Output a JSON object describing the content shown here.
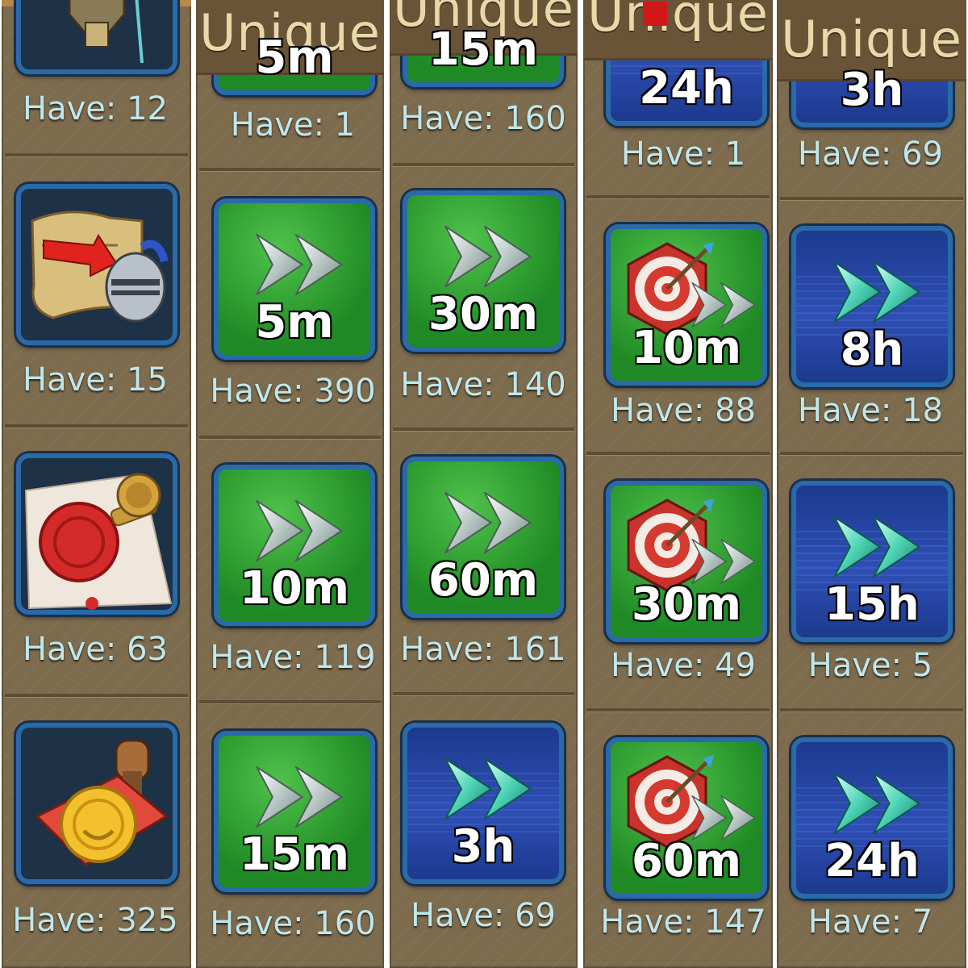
{
  "columns": [
    {
      "items": [
        {
          "have": "Have: 12"
        },
        {
          "have": "Have: 15"
        },
        {
          "have": "Have: 63"
        },
        {
          "have": "Have: 325"
        }
      ]
    },
    {
      "header": "Unique",
      "items": [
        {
          "duration": "5m",
          "have": "Have: 1"
        },
        {
          "duration": "5m",
          "have": "Have: 390"
        },
        {
          "duration": "10m",
          "have": "Have: 119"
        },
        {
          "duration": "15m",
          "have": "Have: 160"
        }
      ]
    },
    {
      "header": "Unique",
      "items": [
        {
          "duration": "15m",
          "have": "Have: 160"
        },
        {
          "duration": "30m",
          "have": "Have: 140"
        },
        {
          "duration": "60m",
          "have": "Have: 161"
        },
        {
          "duration": "3h",
          "have": "Have: 69"
        }
      ]
    },
    {
      "header": "Unique",
      "items": [
        {
          "duration": "24h",
          "have": "Have: 1"
        },
        {
          "duration": "10m",
          "have": "Have: 88"
        },
        {
          "duration": "30m",
          "have": "Have: 49"
        },
        {
          "duration": "60m",
          "have": "Have: 147"
        }
      ]
    },
    {
      "header": "Unique",
      "items": [
        {
          "duration": "3h",
          "have": "Have: 69"
        },
        {
          "duration": "8h",
          "have": "Have: 18"
        },
        {
          "duration": "15h",
          "have": "Have: 5"
        },
        {
          "duration": "24h",
          "have": "Have: 7"
        }
      ]
    }
  ],
  "icons": {
    "col1": [
      "armor-icon",
      "scroll-knight-icon",
      "wax-seal-icon",
      "stamp-icon"
    ],
    "speedup_green": "speedup-green-icon",
    "speedup_blue": "speedup-blue-icon",
    "training": "training-speedup-icon"
  },
  "colors": {
    "panel": "#7d6b4e",
    "header_text": "#e9d9a8",
    "have_text": "#bfe7ec",
    "frame_border": "#2a6aa8",
    "green_tile": "#1f8a25",
    "blue_tile": "#2f4fb6"
  }
}
